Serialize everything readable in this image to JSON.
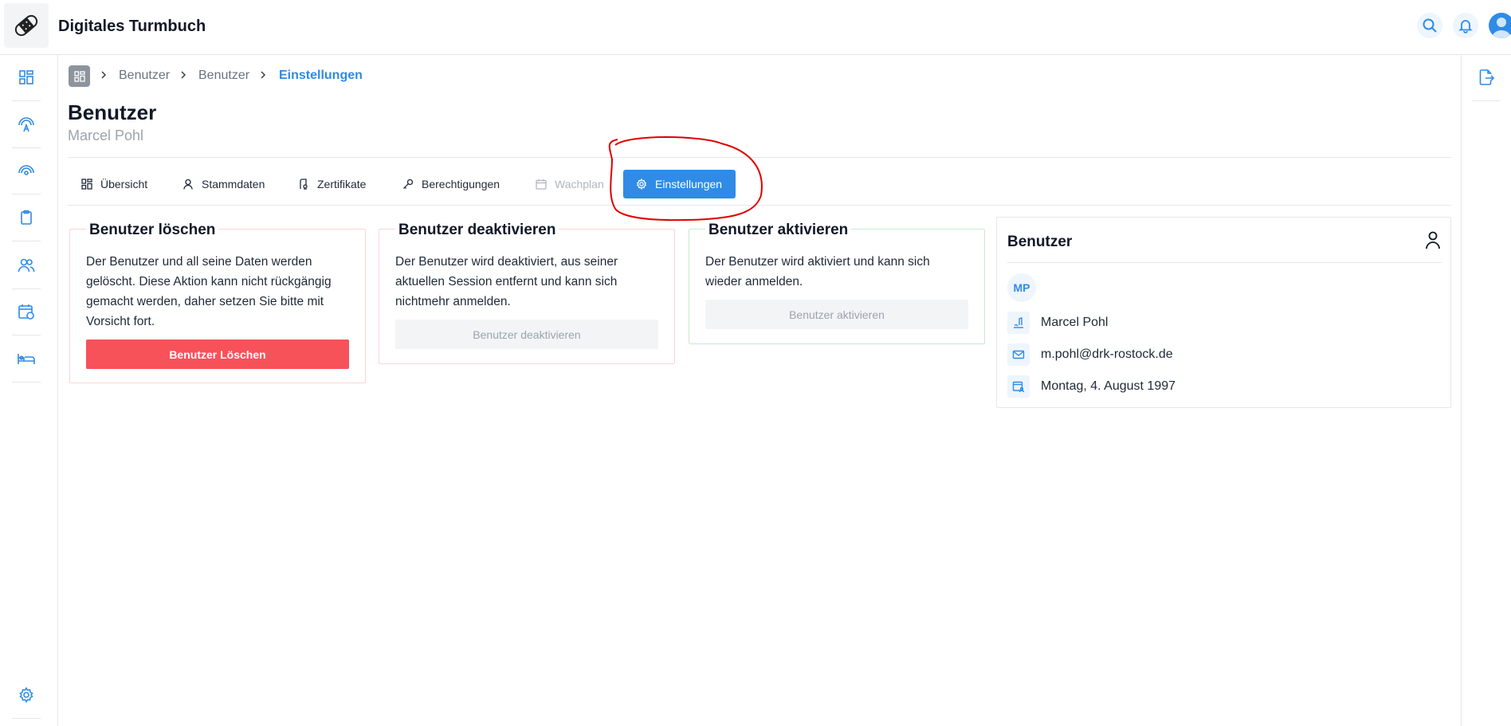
{
  "app": {
    "title": "Digitales Turmbuch"
  },
  "breadcrumb": {
    "items": [
      "Benutzer",
      "Benutzer",
      "Einstellungen"
    ]
  },
  "page": {
    "title": "Benutzer",
    "subtitle": "Marcel Pohl"
  },
  "tabs": [
    {
      "label": "Übersicht",
      "icon": "dashboard-icon",
      "state": "normal"
    },
    {
      "label": "Stammdaten",
      "icon": "person-icon",
      "state": "normal"
    },
    {
      "label": "Zertifikate",
      "icon": "certificate-icon",
      "state": "normal"
    },
    {
      "label": "Berechtigungen",
      "icon": "key-icon",
      "state": "normal"
    },
    {
      "label": "Wachplan",
      "icon": "calendar-icon",
      "state": "disabled"
    },
    {
      "label": "Einstellungen",
      "icon": "gear-icon",
      "state": "active"
    }
  ],
  "cards": {
    "delete": {
      "title": "Benutzer löschen",
      "text": "Der Benutzer und all seine Daten werden gelöscht. Diese Aktion kann nicht rückgängig gemacht werden, daher setzen Sie bitte mit Vorsicht fort.",
      "button": "Benutzer Löschen"
    },
    "deactivate": {
      "title": "Benutzer deaktivieren",
      "text": "Der Benutzer wird deaktiviert, aus seiner aktuellen Session entfernt und kann sich nichtmehr anmelden.",
      "button": "Benutzer deaktivieren"
    },
    "activate": {
      "title": "Benutzer aktivieren",
      "text": "Der Benutzer wird aktiviert und kann sich wieder anmelden.",
      "button": "Benutzer aktivieren"
    }
  },
  "info": {
    "title": "Benutzer",
    "initials": "MP",
    "name": "Marcel Pohl",
    "email": "m.pohl@drk-rostock.de",
    "birthday": "Montag, 4. August 1997"
  },
  "colors": {
    "accent": "#2f8be6",
    "danger": "#f7525a",
    "annotation": "#e00000"
  }
}
